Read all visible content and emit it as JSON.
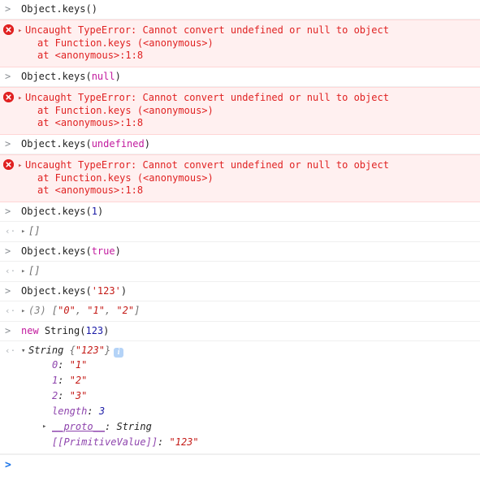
{
  "console": {
    "input_marker": ">",
    "output_marker": "‹·",
    "prompt_marker": ">",
    "prompt_value": "",
    "error_icon_name": "error-circle-icon",
    "colors": {
      "error_text": "#e02222",
      "error_background": "#fff0f0",
      "error_border": "#ffd6d6",
      "keyword": "#c21a9e",
      "number": "#1a1aa6",
      "string": "#c41a16",
      "property": "#8e44ad",
      "preview": "#6e6e6e",
      "prompt_caret": "#1a73e8",
      "info_badge": "#b4d3f7"
    },
    "entries": [
      {
        "kind": "input",
        "expr_parts": [
          {
            "t": "Object.keys(",
            "c": "plain"
          },
          {
            "t": ")",
            "c": "plain"
          }
        ]
      },
      {
        "kind": "error",
        "triangle": "▸",
        "message": "Uncaught TypeError: Cannot convert undefined or null to object",
        "stack": [
          "at Function.keys (<anonymous>)",
          "at <anonymous>:1:8"
        ]
      },
      {
        "kind": "input",
        "expr_parts": [
          {
            "t": "Object.keys(",
            "c": "plain"
          },
          {
            "t": "null",
            "c": "keyword"
          },
          {
            "t": ")",
            "c": "plain"
          }
        ]
      },
      {
        "kind": "error",
        "triangle": "▸",
        "message": "Uncaught TypeError: Cannot convert undefined or null to object",
        "stack": [
          "at Function.keys (<anonymous>)",
          "at <anonymous>:1:8"
        ]
      },
      {
        "kind": "input",
        "expr_parts": [
          {
            "t": "Object.keys(",
            "c": "plain"
          },
          {
            "t": "undefined",
            "c": "keyword"
          },
          {
            "t": ")",
            "c": "plain"
          }
        ]
      },
      {
        "kind": "error",
        "triangle": "▸",
        "message": "Uncaught TypeError: Cannot convert undefined or null to object",
        "stack": [
          "at Function.keys (<anonymous>)",
          "at <anonymous>:1:8"
        ]
      },
      {
        "kind": "input",
        "expr_parts": [
          {
            "t": "Object.keys(",
            "c": "plain"
          },
          {
            "t": "1",
            "c": "number"
          },
          {
            "t": ")",
            "c": "plain"
          }
        ]
      },
      {
        "kind": "output",
        "triangle": "▸",
        "preview_parts": [
          {
            "t": "[]",
            "c": "preview"
          }
        ]
      },
      {
        "kind": "input",
        "expr_parts": [
          {
            "t": "Object.keys(",
            "c": "plain"
          },
          {
            "t": "true",
            "c": "keyword"
          },
          {
            "t": ")",
            "c": "plain"
          }
        ]
      },
      {
        "kind": "output",
        "triangle": "▸",
        "preview_parts": [
          {
            "t": "[]",
            "c": "preview"
          }
        ]
      },
      {
        "kind": "input",
        "expr_parts": [
          {
            "t": "Object.keys(",
            "c": "plain"
          },
          {
            "t": "'123'",
            "c": "string"
          },
          {
            "t": ")",
            "c": "plain"
          }
        ]
      },
      {
        "kind": "output",
        "triangle": "▸",
        "preview_parts": [
          {
            "t": "(3) ",
            "c": "count"
          },
          {
            "t": "[",
            "c": "preview"
          },
          {
            "t": "\"0\"",
            "c": "str"
          },
          {
            "t": ", ",
            "c": "preview"
          },
          {
            "t": "\"1\"",
            "c": "str"
          },
          {
            "t": ", ",
            "c": "preview"
          },
          {
            "t": "\"2\"",
            "c": "str"
          },
          {
            "t": "]",
            "c": "preview"
          }
        ]
      },
      {
        "kind": "input",
        "expr_parts": [
          {
            "t": "new",
            "c": "keyword"
          },
          {
            "t": " String(",
            "c": "plain"
          },
          {
            "t": "123",
            "c": "number"
          },
          {
            "t": ")",
            "c": "plain"
          }
        ]
      },
      {
        "kind": "output-expanded",
        "triangle": "▾",
        "header_parts": [
          {
            "t": "String ",
            "c": "objname"
          },
          {
            "t": "{",
            "c": "preview"
          },
          {
            "t": "\"123\"",
            "c": "str"
          },
          {
            "t": "}",
            "c": "preview"
          }
        ],
        "info_badge": "i",
        "info_badge_name": "info-badge-icon",
        "properties": [
          {
            "name": "0",
            "name_style": "pname",
            "sep": ": ",
            "value": "\"1\"",
            "value_style": "pstr"
          },
          {
            "name": "1",
            "name_style": "pname",
            "sep": ": ",
            "value": "\"2\"",
            "value_style": "pstr"
          },
          {
            "name": "2",
            "name_style": "pname",
            "sep": ": ",
            "value": "\"3\"",
            "value_style": "pstr"
          },
          {
            "name": "length",
            "name_style": "pname",
            "sep": ": ",
            "value": "3",
            "value_style": "pnum"
          },
          {
            "name": "__proto__",
            "name_style": "pname-u",
            "sep": ": ",
            "value": "String",
            "value_style": "pplain",
            "triangle": "▸"
          },
          {
            "name": "[[PrimitiveValue]]",
            "name_style": "pitalic",
            "sep": ": ",
            "value": "\"123\"",
            "value_style": "pstr"
          }
        ]
      }
    ]
  }
}
